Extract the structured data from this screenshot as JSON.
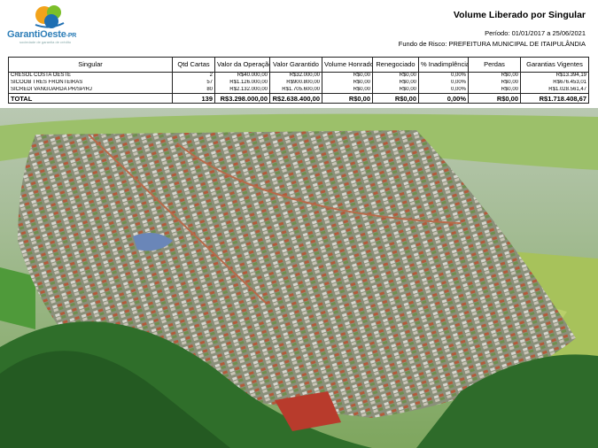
{
  "logo": {
    "brand": "GarantiOeste",
    "suffix": "-PR",
    "tagline": "sociedade de garantia de crédito",
    "colors": {
      "brand": "#2f7fb8",
      "orange": "#f2a31b",
      "green": "#7cbf2a",
      "blue": "#1f6fb2"
    }
  },
  "report": {
    "title": "Volume Liberado por Singular",
    "period_label": "Período:",
    "period_value": "01/01/2017 a 25/06/2021",
    "fund_label": "Fundo de Risco:",
    "fund_value": "PREFEITURA MUNICIPAL DE ITAIPULÂNDIA"
  },
  "table": {
    "headers": [
      "Singular",
      "Qtd Cartas",
      "Valor da Operação",
      "Valor Garantido",
      "Volume Honrado",
      "Renegociado",
      "% Inadimplência",
      "Perdas",
      "Garantias Vigentes"
    ],
    "rows": [
      [
        "CRESOL COSTA OESTE",
        "2",
        "R$40.000,00",
        "R$32.000,00",
        "R$0,00",
        "R$0,00",
        "0,00%",
        "R$0,00",
        "R$13.394,19"
      ],
      [
        "SICOOB TRÊS FRONTEIRAS",
        "57",
        "R$1.126.000,00",
        "R$900.800,00",
        "R$0,00",
        "R$0,00",
        "0,00%",
        "R$0,00",
        "R$676.453,01"
      ],
      [
        "SICREDI VANGUARDA PR/SP/RJ",
        "80",
        "R$2.132.000,00",
        "R$1.705.600,00",
        "R$0,00",
        "R$0,00",
        "0,00%",
        "R$0,00",
        "R$1.028.561,47"
      ]
    ],
    "total": [
      "TOTAL",
      "139",
      "R$3.298.000,00",
      "R$2.638.400,00",
      "R$0,00",
      "R$0,00",
      "0,00%",
      "R$0,00",
      "R$1.718.408,67"
    ]
  }
}
